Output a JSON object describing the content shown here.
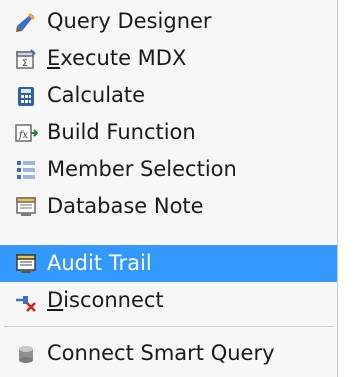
{
  "menu": {
    "items": [
      {
        "label": "Query Designer",
        "icon": "query-designer-icon"
      },
      {
        "prefix": "",
        "underline": "E",
        "rest": "xecute MDX",
        "icon": "execute-mdx-icon"
      },
      {
        "label": "Calculate",
        "icon": "calculator-icon"
      },
      {
        "label": "Build Function",
        "icon": "build-function-icon"
      },
      {
        "label": "Member Selection",
        "icon": "member-selection-icon"
      },
      {
        "label": "Database Note",
        "icon": "database-note-icon"
      },
      {
        "label": "Audit Trail",
        "icon": "audit-trail-icon",
        "selected": true
      },
      {
        "prefix": "",
        "underline": "D",
        "rest": "isconnect",
        "icon": "disconnect-icon"
      },
      {
        "label": "Connect Smart Query",
        "icon": "database-cylinder-icon"
      }
    ]
  },
  "colors": {
    "menu_background": "#f7f7f7",
    "selection": "#3399ff",
    "separator": "#cfcfcf"
  }
}
